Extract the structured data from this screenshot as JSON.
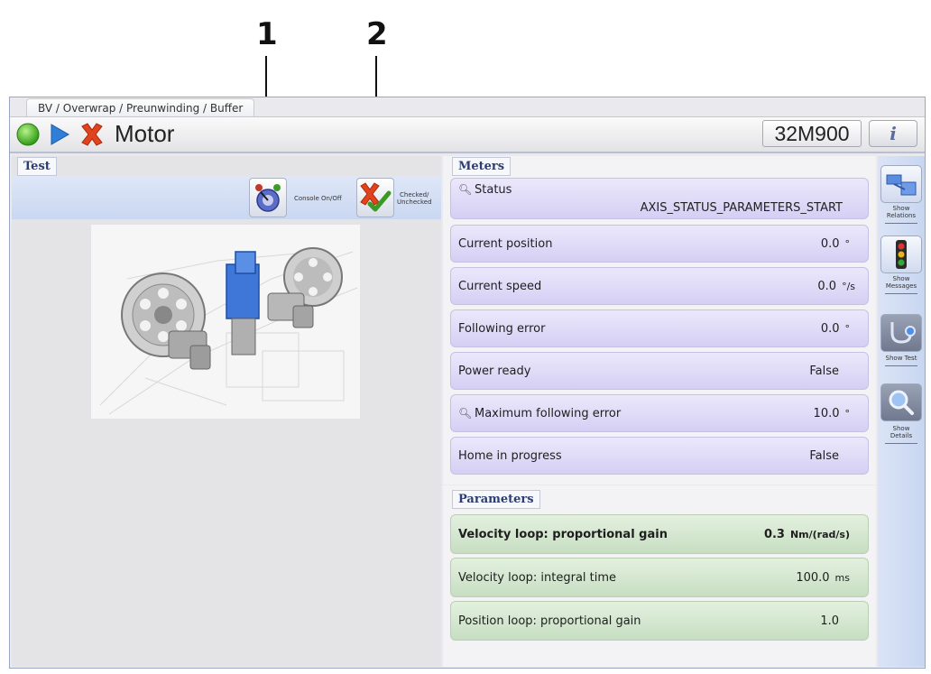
{
  "callouts": [
    "1",
    "2"
  ],
  "breadcrumb": "BV / Overwrap / Preunwinding / Buffer",
  "header": {
    "title": "Motor",
    "code": "32M900",
    "info_label": "i",
    "icons": [
      "green-circle-icon",
      "play-arrow-icon",
      "red-x-icon"
    ]
  },
  "test": {
    "tab": "Test",
    "buttons": [
      {
        "label": "Console On/Off",
        "icon": "console-toggle-icon"
      },
      {
        "label_line1": "Checked/",
        "label_line2": "Unchecked",
        "icon": "check-uncheck-icon"
      }
    ]
  },
  "meters": {
    "tab": "Meters",
    "status_label": "Status",
    "status_value": "AXIS_STATUS_PARAMETERS_START",
    "rows": [
      {
        "label": "Current position",
        "value": "0.0",
        "unit": "°"
      },
      {
        "label": "Current speed",
        "value": "0.0",
        "unit": "°/s"
      },
      {
        "label": "Following error",
        "value": "0.0",
        "unit": "°"
      },
      {
        "label": "Power ready",
        "value": "False",
        "unit": ""
      },
      {
        "label": "Maximum following error",
        "value": "10.0",
        "unit": "°"
      },
      {
        "label": "Home in progress",
        "value": "False",
        "unit": ""
      }
    ]
  },
  "parameters": {
    "tab": "Parameters",
    "rows": [
      {
        "label": "Velocity loop: proportional gain",
        "value": "0.3",
        "unit": "Nm/(rad/s)"
      },
      {
        "label": "Velocity loop: integral time",
        "value": "100.0",
        "unit": "ms"
      },
      {
        "label": "Position loop: proportional gain",
        "value": "1.0",
        "unit": ""
      }
    ]
  },
  "sidebar": [
    {
      "line1": "Show",
      "line2": "Relations",
      "icon": "relations-icon"
    },
    {
      "line1": "Show",
      "line2": "Messages",
      "icon": "traffic-light-icon"
    },
    {
      "line1": "Show Test",
      "line2": "",
      "icon": "stethoscope-icon"
    },
    {
      "line1": "Show",
      "line2": "Details",
      "icon": "magnifier-icon"
    }
  ]
}
